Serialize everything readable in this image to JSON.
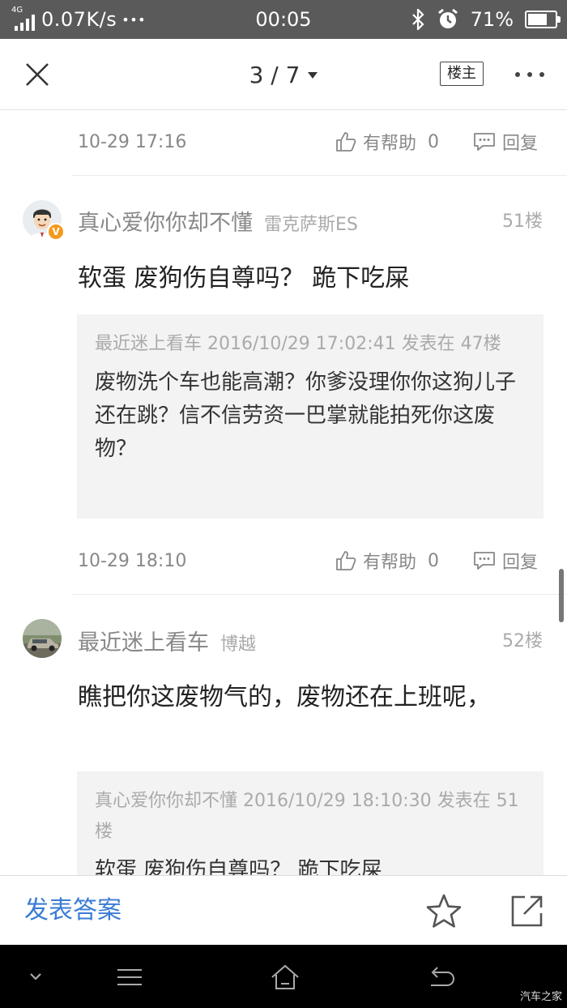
{
  "status_bar": {
    "network_type": "4G",
    "speed": "0.07K/s",
    "dots": "•••",
    "time": "00:05",
    "battery_percent": "71%",
    "battery_level": 0.71,
    "icons": [
      "signal-icon",
      "bluetooth-icon",
      "alarm-icon",
      "battery-icon"
    ]
  },
  "header": {
    "page_indicator": "3 / 7",
    "owner_label": "楼主",
    "icons": [
      "close-icon",
      "caret-down-icon",
      "more-icon"
    ]
  },
  "posts": [
    {
      "footer": {
        "time": "10-29 17:16",
        "like_label": "有帮助",
        "like_count": "0",
        "reply_label": "回复"
      }
    },
    {
      "author": "真心爱你你却不懂",
      "car": "雷克萨斯ES",
      "floor": "51楼",
      "verified_badge": "V",
      "text": "软蛋 废狗伤自尊吗？ 跪下吃屎",
      "quote": {
        "meta": "最近迷上看车  2016/10/29  17:02:41  发表在 47楼",
        "text": "废物洗个车也能高潮？你爹没理你你这狗儿子还在跳？信不信劳资一巴掌就能拍死你这废物？"
      },
      "footer": {
        "time": "10-29 18:10",
        "like_label": "有帮助",
        "like_count": "0",
        "reply_label": "回复"
      }
    },
    {
      "author": "最近迷上看车",
      "car": "博越",
      "floor": "52楼",
      "text": "瞧把你这废物气的，废物还在上班呢，",
      "quote": {
        "meta": "真心爱你你却不懂 2016/10/29 18:10:30 发表在 51楼",
        "text": "软蛋 废狗伤自尊吗？ 跪下吃屎"
      }
    }
  ],
  "action_bar": {
    "answer_label": "发表答案",
    "icons": [
      "star-icon",
      "share-icon"
    ],
    "accent_color": "#3a7bd5"
  },
  "nav_bar": {
    "icons": [
      "chevron-down-icon",
      "menu-icon",
      "home-icon",
      "back-icon"
    ],
    "watermark": "汽车之家"
  }
}
